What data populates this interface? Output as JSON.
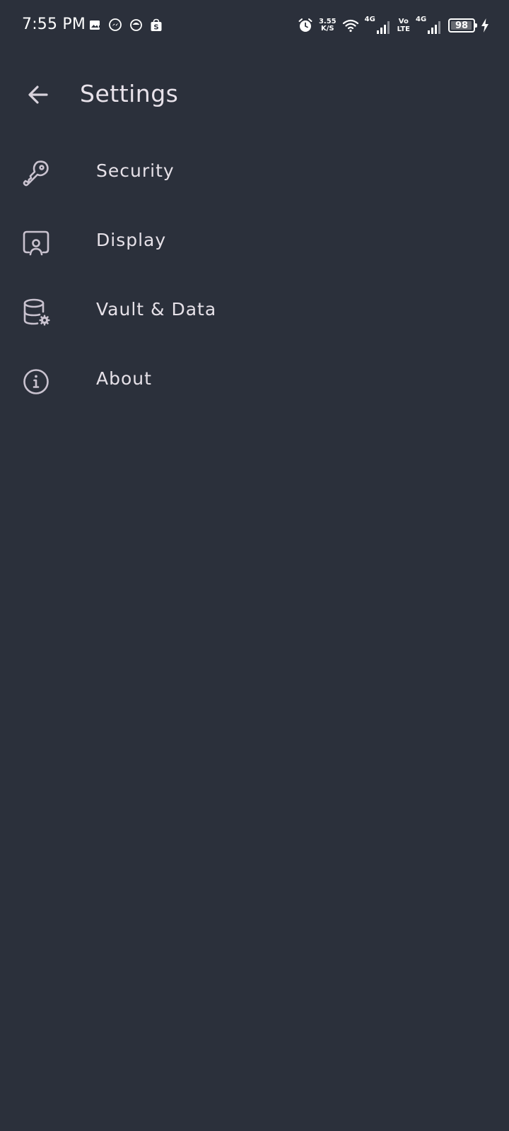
{
  "status_bar": {
    "time": "7:55 PM",
    "net_speed_value": "3.55",
    "net_speed_unit": "K/S",
    "net1_label": "4G",
    "volte_top": "Vo",
    "volte_bottom": "LTE",
    "net2_label": "4G",
    "battery": "98",
    "battery_level_percent": 98
  },
  "header": {
    "title": "Settings"
  },
  "settings": {
    "items": [
      {
        "label": "Security",
        "icon": "key-icon"
      },
      {
        "label": "Display",
        "icon": "display-icon"
      },
      {
        "label": "Vault & Data",
        "icon": "database-settings-icon"
      },
      {
        "label": "About",
        "icon": "info-icon"
      }
    ]
  },
  "colors": {
    "background": "#2b303b",
    "text": "#e6e1e8",
    "icon": "#c9c2cf"
  }
}
